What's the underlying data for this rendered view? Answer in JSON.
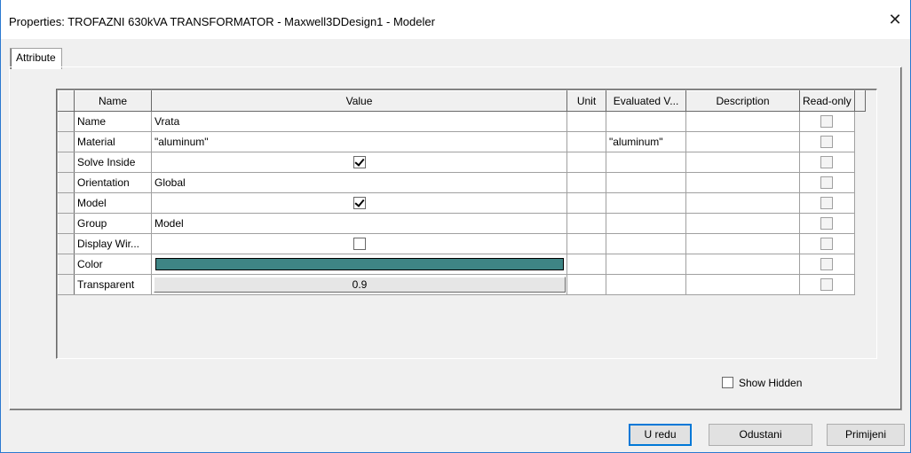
{
  "window": {
    "title": "Properties: TROFAZNI 630kVA TRANSFORMATOR - Maxwell3DDesign1 - Modeler",
    "close_glyph": "✕"
  },
  "tabs": [
    {
      "label": "Attribute",
      "selected": true
    }
  ],
  "grid": {
    "columns": [
      "Name",
      "Value",
      "Unit",
      "Evaluated V...",
      "Description",
      "Read-only"
    ],
    "rows": [
      {
        "name": "Name",
        "value": "Vrata",
        "unit": "",
        "evaluated": "",
        "description": "",
        "read_only": false
      },
      {
        "name": "Material",
        "value": "\"aluminum\"",
        "unit": "",
        "evaluated": "\"aluminum\"",
        "description": "",
        "read_only": false
      },
      {
        "name": "Solve Inside",
        "value_checkbox": true,
        "unit": "",
        "evaluated": "",
        "description": "",
        "read_only": false
      },
      {
        "name": "Orientation",
        "value": "Global",
        "unit": "",
        "evaluated": "",
        "description": "",
        "read_only": false
      },
      {
        "name": "Model",
        "value_checkbox": true,
        "unit": "",
        "evaluated": "",
        "description": "",
        "read_only": false
      },
      {
        "name": "Group",
        "value": "Model",
        "unit": "",
        "evaluated": "",
        "description": "",
        "read_only": false
      },
      {
        "name": "Display Wir...",
        "value_checkbox": false,
        "unit": "",
        "evaluated": "",
        "description": "",
        "read_only": false
      },
      {
        "name": "Color",
        "value_color": "#3e8585",
        "unit": "",
        "evaluated": "",
        "description": "",
        "read_only": false
      },
      {
        "name": "Transparent",
        "value": "0.9",
        "unit": "",
        "evaluated": "",
        "description": "",
        "read_only": false
      }
    ]
  },
  "show_hidden": {
    "label": "Show Hidden",
    "checked": false
  },
  "buttons": {
    "ok": "U redu",
    "cancel": "Odustani",
    "apply": "Primijeni"
  },
  "colors": {
    "accent": "#0078d7",
    "object_color": "#3e8585"
  }
}
